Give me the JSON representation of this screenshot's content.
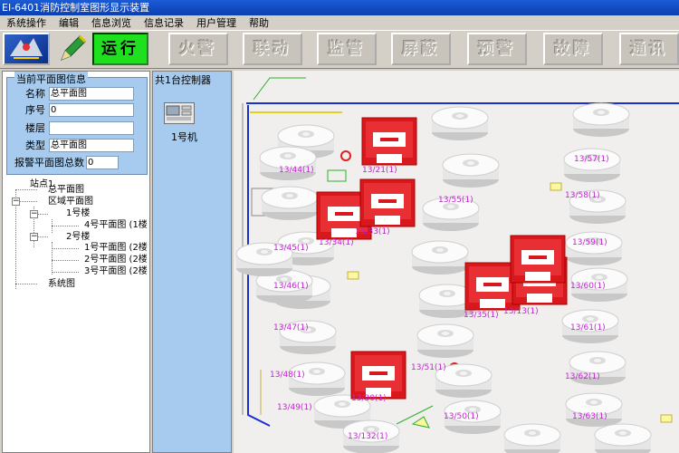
{
  "window": {
    "title": "EI-6401消防控制室图形显示装置"
  },
  "menu": {
    "items": [
      "系统操作",
      "编辑",
      "信息浏览",
      "信息记录",
      "用户管理",
      "帮助"
    ]
  },
  "toolbar": {
    "buttons": [
      "运行",
      "火警",
      "联动",
      "监管",
      "屏蔽",
      "预警",
      "故障",
      "通讯"
    ],
    "active_color": "#1ee01e"
  },
  "info": {
    "title": "当前平面图信息",
    "name_label": "名称",
    "name_value": "总平面图",
    "seq_label": "序号",
    "seq_value": "0",
    "floor_label": "楼层",
    "floor_value": "",
    "type_label": "类型",
    "type_value": "总平面图",
    "alarm_label": "报警平面图总数",
    "alarm_value": "0"
  },
  "tree": {
    "items": [
      "站点1",
      "总平面图",
      "区域平面图",
      "1号楼",
      "4号平面图 (1楼",
      "2号楼",
      "1号平面图 (2楼",
      "2号平面图 (2楼",
      "3号平面图 (2楼",
      "系统图"
    ]
  },
  "controllers": {
    "header": "共1台控制器",
    "items": [
      "1号机"
    ]
  },
  "map": {
    "detector_labels": [
      "13/44(1)",
      "13/45(1)",
      "13/46(1)",
      "13/47(1)",
      "13/48(1)",
      "13/49(1)",
      "13/21(1)",
      "13/34(1)",
      "13/33(1)",
      "13/30(1)",
      "13/132(1)",
      "13/55(1)",
      "13/35(1)",
      "13/51(1)",
      "13/50(1)",
      "13/13(1)",
      "13/57(1)",
      "13/58(1)",
      "13/59(1)",
      "13/60(1)",
      "13/61(1)",
      "13/62(1)",
      "13/63(1)"
    ],
    "colors": {
      "alarm": "#e02020",
      "label": "#c81ed8",
      "wall": "#1a2fd0"
    }
  }
}
